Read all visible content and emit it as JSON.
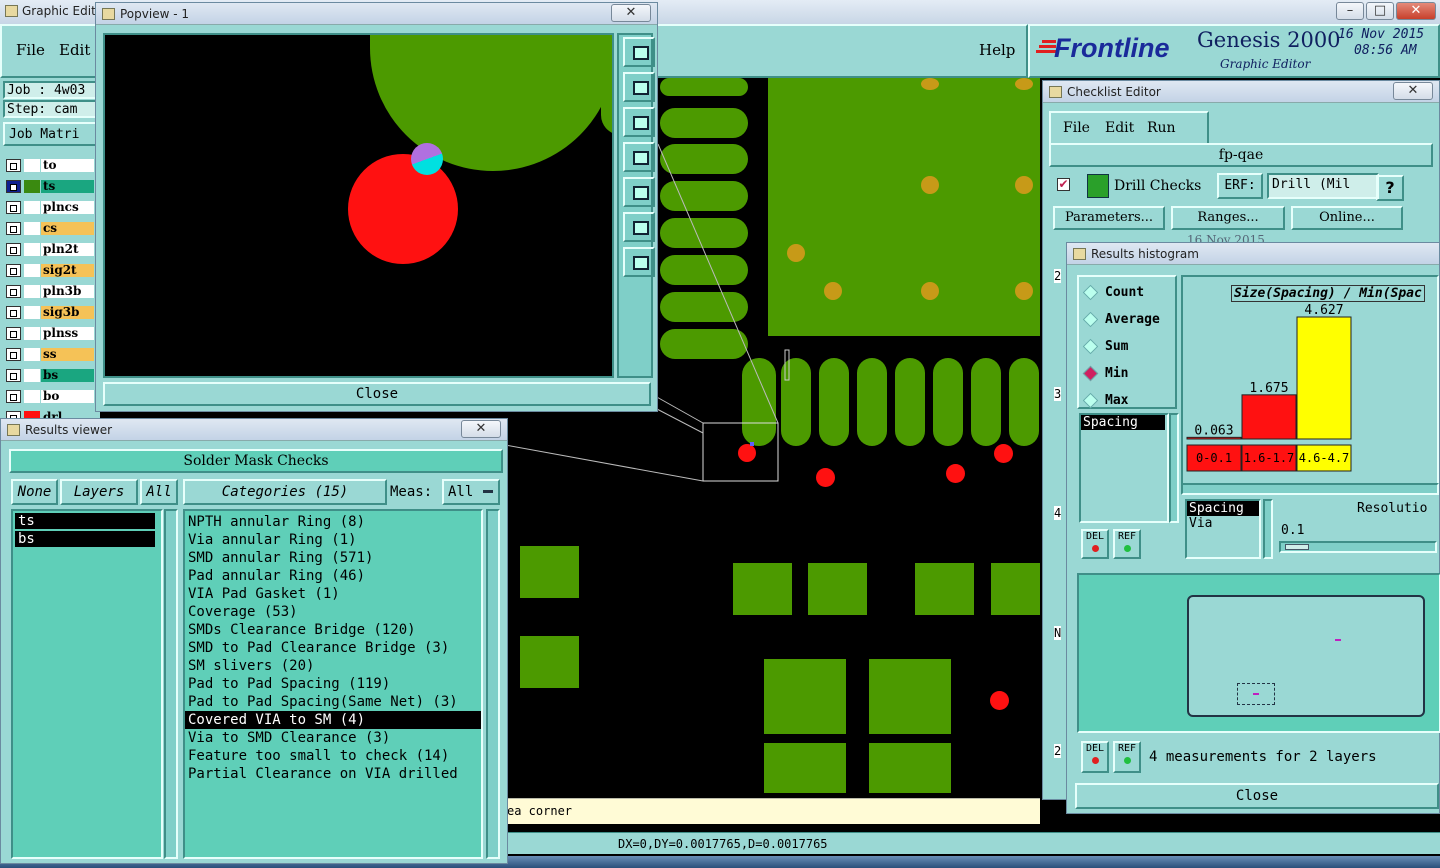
{
  "main": {
    "title": "Graphic Edit",
    "menu": [
      "File",
      "Edit"
    ],
    "help": "Help",
    "job_label": "Job : 4w03",
    "step_label": "Step: cam",
    "job_matrix": "Job Matri",
    "brand": "Frontline",
    "product": "Genesis 2000",
    "product_sub": "Graphic Editor",
    "date": "16 Nov 2015",
    "time": "08:56 AM",
    "status_hint": "ea corner",
    "coords": "DX=0,DY=0.0017765,D=0.0017765"
  },
  "layers": [
    {
      "name": "to",
      "color": "#ffffff",
      "swatch": "#ffffff",
      "active": false
    },
    {
      "name": "ts",
      "color": "#1aa680",
      "swatch": "#3a8a10",
      "active": true
    },
    {
      "name": "plncs",
      "color": "#ffffff",
      "swatch": "#ffffff",
      "active": false
    },
    {
      "name": "cs",
      "color": "#f5c257",
      "swatch": "#ffffff",
      "active": false
    },
    {
      "name": "pln2t",
      "color": "#ffffff",
      "swatch": "#ffffff",
      "active": false
    },
    {
      "name": "sig2t",
      "color": "#f5c257",
      "swatch": "#ffffff",
      "active": false
    },
    {
      "name": "pln3b",
      "color": "#ffffff",
      "swatch": "#ffffff",
      "active": false
    },
    {
      "name": "sig3b",
      "color": "#f5c257",
      "swatch": "#ffffff",
      "active": false
    },
    {
      "name": "plnss",
      "color": "#ffffff",
      "swatch": "#ffffff",
      "active": false
    },
    {
      "name": "ss",
      "color": "#f5c257",
      "swatch": "#ffffff",
      "active": false
    },
    {
      "name": "bs",
      "color": "#1aa680",
      "swatch": "#ffffff",
      "active": false
    },
    {
      "name": "bo",
      "color": "#ffffff",
      "swatch": "#ffffff",
      "active": false
    },
    {
      "name": "drl",
      "color": "#9ad8d4",
      "swatch": "#ff1111",
      "active": false
    }
  ],
  "popview": {
    "title": "Popview - 1",
    "close": "Close",
    "tool_icons": [
      "zoom-fit-icon",
      "move-up-icon",
      "move-down-icon",
      "move-left-icon",
      "move-right-icon",
      "zoom-out-icon",
      "zoom-in-icon"
    ]
  },
  "results_viewer": {
    "title": "Results viewer",
    "header": "Solder Mask Checks",
    "none_btn": "None",
    "layers_btn": "Layers",
    "all_btn": "All",
    "categories_btn": "Categories (15)",
    "meas_label": "Meas:",
    "meas_value": "All",
    "layer_list": [
      "ts",
      "bs"
    ],
    "categories": [
      "NPTH annular Ring (8)",
      "Via annular Ring (1)",
      "SMD annular Ring (571)",
      "Pad annular Ring (46)",
      "VIA Pad Gasket (1)",
      "Coverage (53)",
      "SMDs Clearance Bridge (120)",
      "SMD to Pad Clearance Bridge (3)",
      "SM slivers (20)",
      "Pad to Pad Spacing (119)",
      "Pad to Pad Spacing(Same Net) (3)",
      "Covered VIA to SM (4)",
      "Via to SMD Clearance (3)",
      "Feature too small to check (14)",
      "Partial Clearance on VIA drilled"
    ],
    "selected_index": 11
  },
  "checklist": {
    "title": "Checklist Editor",
    "menu": [
      "File",
      "Edit",
      "Run"
    ],
    "name": "fp-qae",
    "drill_checks": "Drill Checks",
    "erf_label": "ERF:",
    "erf_value": "Drill (Mil",
    "help_btn": "?",
    "buttons": [
      "Parameters...",
      "Ranges...",
      "Online..."
    ],
    "date_partial": "16 Nov 2015",
    "side_digits": [
      "2",
      "3",
      "4",
      "N",
      "2"
    ]
  },
  "histogram": {
    "title": "Results histogram",
    "modes": [
      "Count",
      "Average",
      "Sum",
      "Min",
      "Max"
    ],
    "selected_mode": "Min",
    "chart_title": "Size(Spacing) / Min(Spac",
    "type_list": [
      "Spacing"
    ],
    "del": "DEL",
    "ref": "REF",
    "sub_list": [
      "Spacing",
      "Via"
    ],
    "resolution_label": "Resolutio",
    "resolution_value": "0.1",
    "summary": "4 measurements for 2 layers",
    "close": "Close"
  },
  "chart_data": {
    "type": "bar",
    "categories": [
      "0-0.1",
      "1.6-1.7",
      "4.6-4.7"
    ],
    "values": [
      0.063,
      1.675,
      4.627
    ],
    "value_labels": [
      "0.063",
      "1.675",
      "4.627"
    ],
    "colors": [
      "#ff1111",
      "#ff1111",
      "#ffff00"
    ],
    "title": "Size(Spacing) / Min(Spac",
    "ylim": [
      0,
      4.627
    ]
  }
}
